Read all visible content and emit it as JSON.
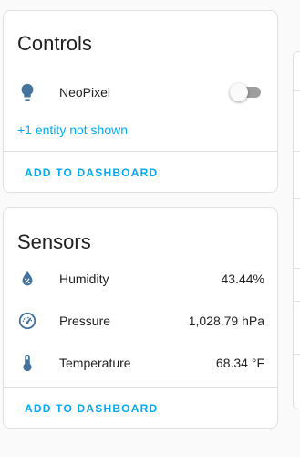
{
  "colors": {
    "accent": "#03a9f4",
    "icon": "#44739e",
    "text": "#212121",
    "divider": "#e0e0e0",
    "toggle_off_track": "#9e9e9e"
  },
  "controls": {
    "title": "Controls",
    "entities": [
      {
        "label": "NeoPixel",
        "icon": "lightbulb-icon",
        "state": "off"
      }
    ],
    "more_link": "+1 entity not shown",
    "action_label": "ADD TO DASHBOARD"
  },
  "sensors": {
    "title": "Sensors",
    "entities": [
      {
        "label": "Humidity",
        "icon": "water-percent-icon",
        "value": "43.44%"
      },
      {
        "label": "Pressure",
        "icon": "gauge-icon",
        "value": "1,028.79 hPa"
      },
      {
        "label": "Temperature",
        "icon": "thermometer-icon",
        "value": "68.34 °F"
      }
    ],
    "action_label": "ADD TO DASHBOARD"
  }
}
